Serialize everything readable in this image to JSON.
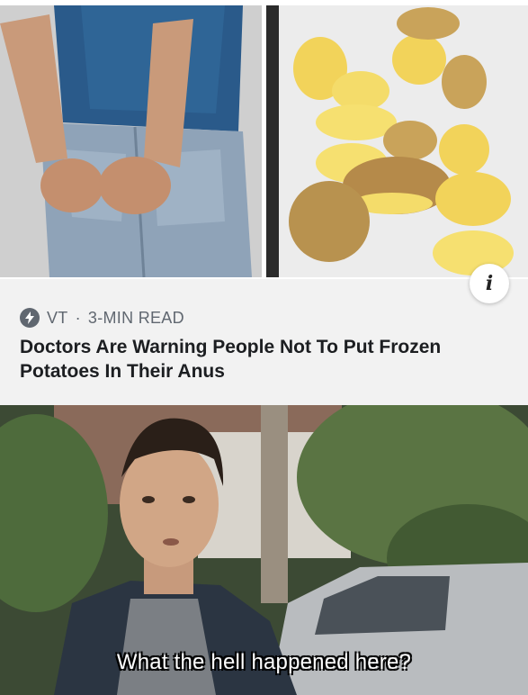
{
  "article": {
    "source": "VT",
    "separator": "·",
    "read_time": "3-MIN READ",
    "headline": "Doctors Are Warning People Not To Put Frozen Potatoes In Their Anus"
  },
  "info_button": {
    "glyph": "i"
  },
  "meme": {
    "caption": "What the hell happened here?"
  },
  "colors": {
    "card_bg": "#f2f2f2",
    "meta_text": "#606770",
    "headline_text": "#1c1e21"
  }
}
